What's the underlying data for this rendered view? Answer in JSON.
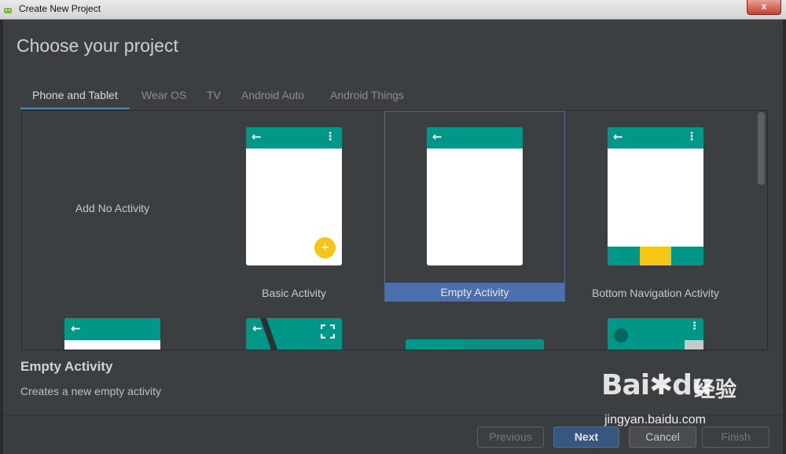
{
  "window": {
    "title": "Create New Project",
    "close_label": "x"
  },
  "dialog": {
    "heading": "Choose your project",
    "tabs": [
      {
        "label": "Phone and Tablet",
        "active": true
      },
      {
        "label": "Wear OS"
      },
      {
        "label": "TV"
      },
      {
        "label": "Android Auto"
      },
      {
        "label": "Android Things"
      }
    ],
    "templates": [
      {
        "label": "Add No Activity"
      },
      {
        "label": "Basic Activity"
      },
      {
        "label": "Empty Activity",
        "selected": true
      },
      {
        "label": "Bottom Navigation Activity"
      }
    ],
    "description": {
      "title": "Empty Activity",
      "body": "Creates a new empty activity"
    },
    "buttons": {
      "previous": "Previous",
      "next": "Next",
      "cancel": "Cancel",
      "finish": "Finish"
    }
  },
  "glyphs": {
    "back": "←",
    "overflow": "⋮",
    "plus": "+",
    "fullscreen": "⛶"
  },
  "colors": {
    "accent": "#009688",
    "fab": "#f5c518",
    "selection": "#4b6eaf"
  },
  "watermark": {
    "logo_text": "Bai",
    "logo_text2": "du",
    "cn": "经验",
    "url": "jingyan.baidu.com"
  }
}
